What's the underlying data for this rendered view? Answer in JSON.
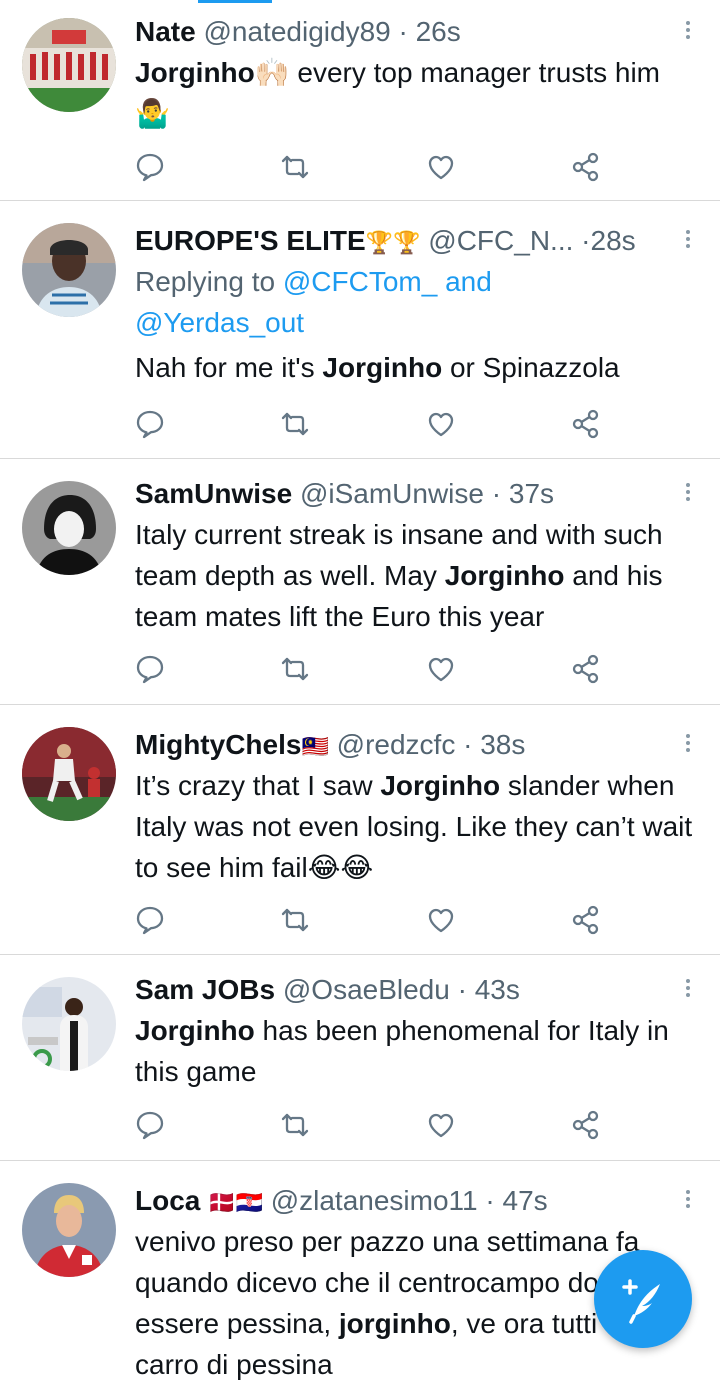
{
  "timeline": {
    "tweets": [
      {
        "display_name": "Nate",
        "name_flags": "",
        "handle": "@natedigidy89",
        "separator": "·",
        "time": "26s",
        "replying_prefix": "",
        "replying_to": [],
        "text_segments": [
          {
            "text": "Jorginho",
            "bold": true
          },
          {
            "text": "🙌🏻 every top manager trusts him 🤷‍♂️",
            "bold": false
          }
        ]
      },
      {
        "display_name": "EUROPE'S ELITE",
        "name_flags": "🏆🏆",
        "handle": "@CFC_N...",
        "separator": "·",
        "time": "28s",
        "replying_prefix": "Replying to",
        "replying_to": [
          "@CFCTom_ and",
          "@Yerdas_out"
        ],
        "text_segments": [
          {
            "text": "Nah for me it's ",
            "bold": false
          },
          {
            "text": "Jorginho",
            "bold": true
          },
          {
            "text": " or Spinazzola",
            "bold": false
          }
        ]
      },
      {
        "display_name": "SamUnwise",
        "name_flags": "",
        "handle": "@iSamUnwise",
        "separator": "·",
        "time": "37s",
        "replying_prefix": "",
        "replying_to": [],
        "text_segments": [
          {
            "text": "Italy current streak is insane and with such team depth as well. May ",
            "bold": false
          },
          {
            "text": "Jorginho",
            "bold": true
          },
          {
            "text": " and his team mates lift the Euro this year",
            "bold": false
          }
        ]
      },
      {
        "display_name": "MightyChels",
        "name_flags": "🇲🇾",
        "handle": "@redzcfc",
        "separator": "·",
        "time": "38s",
        "replying_prefix": "",
        "replying_to": [],
        "text_segments": [
          {
            "text": "It’s crazy that I saw ",
            "bold": false
          },
          {
            "text": "Jorginho",
            "bold": true
          },
          {
            "text": " slander when Italy was not even losing. Like they can’t wait to see him fail😂😂",
            "bold": false
          }
        ]
      },
      {
        "display_name": "Sam JOBs",
        "name_flags": "",
        "handle": "@OsaeBledu",
        "separator": "·",
        "time": "43s",
        "replying_prefix": "",
        "replying_to": [],
        "text_segments": [
          {
            "text": "Jorginho",
            "bold": true
          },
          {
            "text": " has been phenomenal for Italy in this game",
            "bold": false
          }
        ]
      },
      {
        "display_name": "Loca",
        "name_flags": "🇩🇰🇭🇷",
        "handle": "@zlatanesimo11",
        "separator": "·",
        "time": "47s",
        "replying_prefix": "",
        "replying_to": [],
        "text_segments": [
          {
            "text": "venivo preso per pazzo una settimana fa quando dicevo che il centrocampo ",
            "bold": false
          },
          {
            "text": "doveva essere pessina, ",
            "bold": false
          },
          {
            "text": "jorginho",
            "bold": true
          },
          {
            "text": ", ve",
            "bold": false
          },
          {
            "text": " ora tutti sul carro di pessina",
            "bold": false
          }
        ]
      }
    ]
  },
  "icons": {
    "reply": "reply-icon",
    "retweet": "retweet-icon",
    "like": "like-icon",
    "share": "share-icon",
    "more": "more-vertical-icon",
    "compose": "compose-tweet-icon"
  },
  "colors": {
    "accent": "#1d9bf0",
    "secondary_text": "#536471",
    "icon_gray": "#657786",
    "divider": "#d9d9d9"
  }
}
